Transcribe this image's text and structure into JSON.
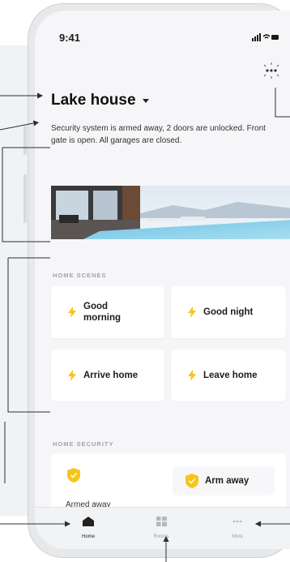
{
  "status": {
    "time": "9:41",
    "icons": "signal-wifi-battery"
  },
  "header": {
    "house_name": "Lake house",
    "dropdown": "chevron-down-icon"
  },
  "summary": "Security system is armed away, 2 doors are unlocked. Front gate is open. All garages are closed.",
  "sections": {
    "scenes_label": "HOME SCENES",
    "security_label": "HOME SECURITY"
  },
  "scenes": [
    {
      "label": "Good morning",
      "icon": "lightning-icon"
    },
    {
      "label": "Good night",
      "icon": "lightning-icon"
    },
    {
      "label": "Arrive home",
      "icon": "lightning-icon"
    },
    {
      "label": "Leave home",
      "icon": "lightning-icon"
    }
  ],
  "security": {
    "status_label": "Armed away",
    "action_label": "Arm away"
  },
  "tabbar": [
    {
      "label": "Home",
      "icon": "home-icon",
      "active": true
    },
    {
      "label": "Rooms",
      "icon": "rooms-icon",
      "active": false
    },
    {
      "label": "More",
      "icon": "more-dots-icon",
      "active": false
    }
  ],
  "colors": {
    "accent": "#f5c518",
    "callout": "#2a2f3a"
  }
}
